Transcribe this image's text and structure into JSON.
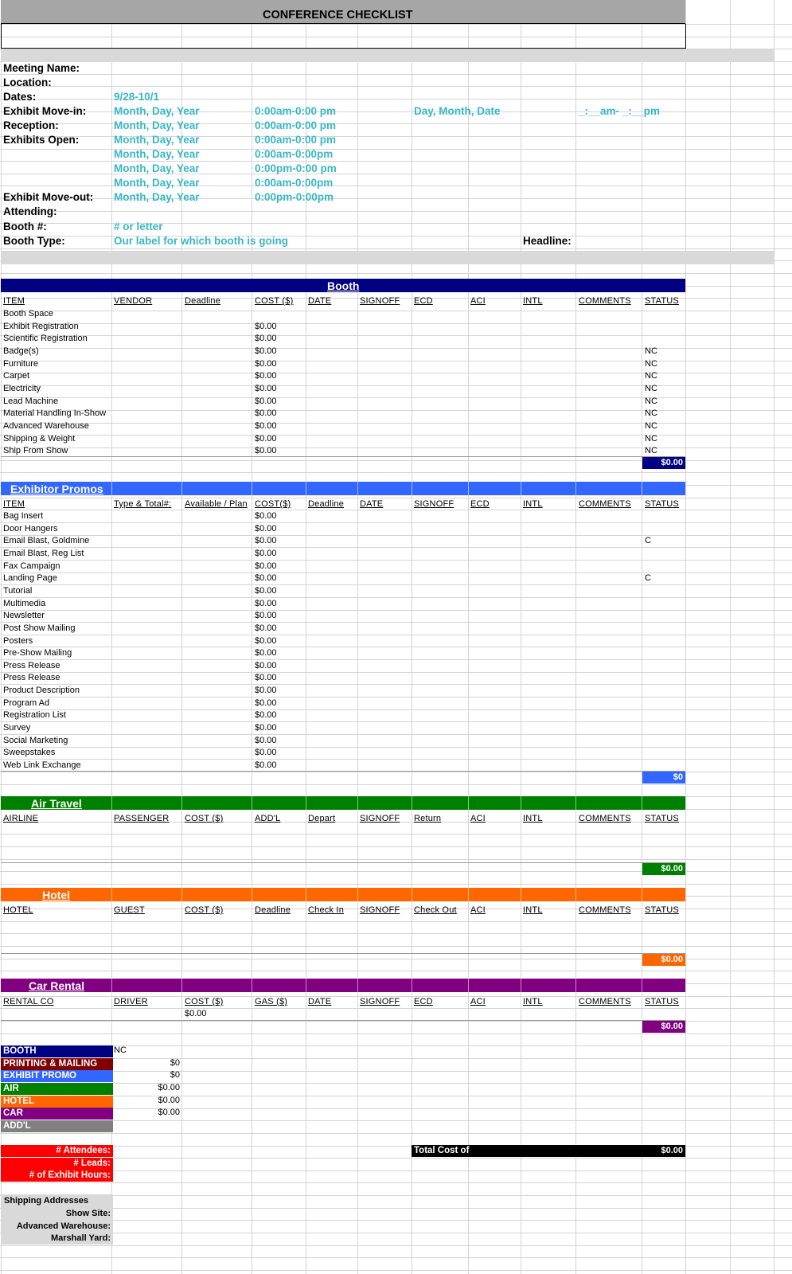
{
  "title": "CONFERENCE CHECKLIST",
  "details": [
    {
      "label": "Meeting Name:",
      "c1": "",
      "c2": "",
      "c3": "",
      "c4": ""
    },
    {
      "label": "Location:",
      "c1": "",
      "c2": "",
      "c3": "",
      "c4": ""
    },
    {
      "label": "Dates:",
      "c1": "9/28-10/1",
      "c2": "",
      "c3": "",
      "c4": ""
    },
    {
      "label": "Exhibit Move-in:",
      "c1": "Month, Day, Year",
      "c2": "0:00am-0:00 pm",
      "c3": "Day, Month, Date",
      "c4": "_:__am- _:__pm"
    },
    {
      "label": "Reception:",
      "c1": "Month, Day, Year",
      "c2": "0:00am-0:00 pm",
      "c3": "",
      "c4": ""
    },
    {
      "label": "Exhibits Open:",
      "c1": "Month, Day, Year",
      "c2": "0:00am-0:00 pm",
      "c3": "",
      "c4": ""
    },
    {
      "label": "",
      "c1": "Month, Day, Year",
      "c2": "0:00am-0:00pm",
      "c3": "",
      "c4": ""
    },
    {
      "label": "",
      "c1": "Month, Day, Year",
      "c2": "0:00pm-0:00 pm",
      "c3": "",
      "c4": ""
    },
    {
      "label": "",
      "c1": "Month, Day, Year",
      "c2": "0:00am-0:00pm",
      "c3": "",
      "c4": ""
    },
    {
      "label": "Exhibit Move-out:",
      "c1": "Month, Day, Year",
      "c2": "0:00pm-0:00pm",
      "c3": "",
      "c4": ""
    },
    {
      "label": "Attending:",
      "c1": "",
      "c2": "",
      "c3": "",
      "c4": ""
    },
    {
      "label": "Booth #:",
      "c1": "# or letter",
      "c2": "",
      "c3": "",
      "c4": ""
    },
    {
      "label": "Booth Type:",
      "c1": "Our label for which booth is going",
      "c2": "",
      "c3": "",
      "c4": ""
    }
  ],
  "headline_label": "Headline:",
  "booth": {
    "title": "Booth",
    "color": "#000080",
    "headers": [
      "ITEM",
      "VENDOR",
      "Deadline",
      "COST ($)",
      "DATE",
      "SIGNOFF",
      "ECD",
      "ACI",
      "INTL",
      "COMMENTS",
      "STATUS"
    ],
    "rows": [
      {
        "item": "Booth Space",
        "cost": "",
        "status": ""
      },
      {
        "item": "Exhibit Registration",
        "cost": "$0.00",
        "status": ""
      },
      {
        "item": "Scientific Registration",
        "cost": "$0.00",
        "status": ""
      },
      {
        "item": "Badge(s)",
        "cost": "$0.00",
        "status": "NC"
      },
      {
        "item": "Furniture",
        "cost": "$0.00",
        "status": "NC"
      },
      {
        "item": "Carpet",
        "cost": "$0.00",
        "status": "NC"
      },
      {
        "item": "Electricity",
        "cost": "$0.00",
        "status": "NC"
      },
      {
        "item": "Lead Machine",
        "cost": "$0.00",
        "status": "NC"
      },
      {
        "item": "Material Handling In-Show",
        "cost": "$0.00",
        "status": "NC"
      },
      {
        "item": "Advanced Warehouse",
        "cost": "$0.00",
        "status": "NC"
      },
      {
        "item": "Shipping & Weight",
        "cost": "$0.00",
        "status": "NC"
      },
      {
        "item": "Ship From Show",
        "cost": "$0.00",
        "status": "NC"
      }
    ],
    "total": "$0.00"
  },
  "promos": {
    "title": "Exhibitor Promos",
    "color": "#3366ff",
    "headers": [
      "ITEM",
      "Type & Total#:",
      "Available / Plan",
      "COST($)",
      "Deadline",
      "DATE",
      "SIGNOFF",
      "ECD",
      "INTL",
      "COMMENTS",
      "STATUS"
    ],
    "rows": [
      {
        "item": "Bag Insert",
        "cost": "$0.00",
        "status": ""
      },
      {
        "item": "Door Hangers",
        "cost": "$0.00",
        "status": ""
      },
      {
        "item": "Email Blast, Goldmine",
        "cost": "$0.00",
        "status": "C"
      },
      {
        "item": "Email Blast, Reg List",
        "cost": "$0.00",
        "status": ""
      },
      {
        "item": "Fax Campaign",
        "cost": "$0.00",
        "status": ""
      },
      {
        "item": "Landing Page",
        "cost": "$0.00",
        "status": "C"
      },
      {
        "item": "Tutorial",
        "cost": "$0.00",
        "status": ""
      },
      {
        "item": "Multimedia",
        "cost": "$0.00",
        "status": ""
      },
      {
        "item": "Newsletter",
        "cost": "$0.00",
        "status": ""
      },
      {
        "item": "Post Show Mailing",
        "cost": "$0.00",
        "status": ""
      },
      {
        "item": "Posters",
        "cost": "$0.00",
        "status": ""
      },
      {
        "item": "Pre-Show Mailing",
        "cost": "$0.00",
        "status": ""
      },
      {
        "item": "Press Release",
        "cost": "$0.00",
        "status": ""
      },
      {
        "item": "Press Release",
        "cost": "$0.00",
        "status": ""
      },
      {
        "item": "Product Description",
        "cost": "$0.00",
        "status": ""
      },
      {
        "item": "Program Ad",
        "cost": "$0.00",
        "status": ""
      },
      {
        "item": "Registration List",
        "cost": "$0.00",
        "status": ""
      },
      {
        "item": "Survey",
        "cost": "$0.00",
        "status": ""
      },
      {
        "item": "Social Marketing",
        "cost": "$0.00",
        "status": ""
      },
      {
        "item": "Sweepstakes",
        "cost": "$0.00",
        "status": ""
      },
      {
        "item": "Web Link Exchange",
        "cost": "$0.00",
        "status": ""
      }
    ],
    "total": "$0"
  },
  "air": {
    "title": "Air Travel",
    "color": "#008000",
    "headers": [
      "AIRLINE",
      "PASSENGER",
      "COST ($)",
      "ADD'L",
      "Depart",
      "SIGNOFF",
      "Return",
      "ACI",
      "INTL",
      "COMMENTS",
      "STATUS"
    ],
    "total": "$0.00"
  },
  "hotel": {
    "title": "Hotel",
    "color": "#ff6600",
    "headers": [
      "HOTEL",
      "GUEST",
      "COST ($)",
      "Deadline",
      "Check In",
      "SIGNOFF",
      "Check Out",
      "ACI",
      "INTL",
      "COMMENTS",
      "STATUS"
    ],
    "total": "$0.00"
  },
  "car": {
    "title": "Car Rental",
    "color": "#800080",
    "headers": [
      "RENTAL CO",
      "DRIVER",
      "COST ($)",
      "GAS ($)",
      "DATE",
      "SIGNOFF",
      "ECD",
      "ACI",
      "INTL",
      "COMMENTS",
      "STATUS"
    ],
    "cost_value": "$0.00",
    "total": "$0.00"
  },
  "summary": [
    {
      "label": "BOOTH",
      "color": "#000080",
      "value": "NC"
    },
    {
      "label": "PRINTING & MAILING",
      "color": "#800000",
      "value": "$0"
    },
    {
      "label": "EXHIBIT PROMO",
      "color": "#3366ff",
      "value": "$0"
    },
    {
      "label": "AIR",
      "color": "#008000",
      "value": "$0.00"
    },
    {
      "label": "HOTEL",
      "color": "#ff6600",
      "value": "$0.00"
    },
    {
      "label": "CAR",
      "color": "#800080",
      "value": "$0.00"
    },
    {
      "label": "ADD'L",
      "color": "#808080",
      "value": ""
    }
  ],
  "metrics": [
    "# Attendees:",
    "# Leads:",
    "# of Exhibit Hours:"
  ],
  "total_cost_label": "Total Cost of",
  "total_cost_value": "$0.00",
  "shipping": {
    "title": "Shipping Addresses",
    "rows": [
      "Show Site:",
      "Advanced Warehouse:",
      "Marshall Yard:"
    ]
  }
}
